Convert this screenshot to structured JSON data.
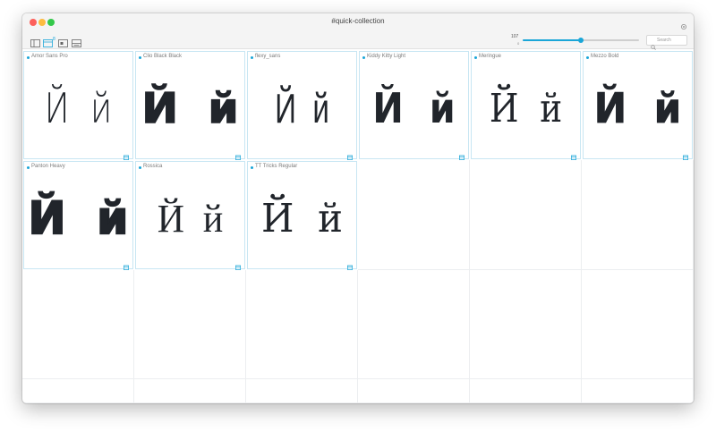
{
  "window": {
    "title": "#quick-collection"
  },
  "toolbar": {
    "count": "8",
    "size_value": "107",
    "size_min": "0",
    "size_level": 0.5,
    "search_placeholder": "Search"
  },
  "colors": {
    "accent": "#1aa6d8",
    "glyph": "#21252b"
  },
  "sample": "Й  й",
  "fonts": [
    {
      "name": "Amor Sans Pro",
      "style": "light-sans"
    },
    {
      "name": "Clio Black Black",
      "style": "black-sans"
    },
    {
      "name": "flexy_sans",
      "style": "condensed-sans"
    },
    {
      "name": "Kiddy Kitty Light",
      "style": "rounded"
    },
    {
      "name": "Meringue",
      "style": "serif-light"
    },
    {
      "name": "Mezzo Bold",
      "style": "bold-sans"
    },
    {
      "name": "Panton Heavy",
      "style": "heavy-rounded"
    },
    {
      "name": "Rossica",
      "style": "serif"
    },
    {
      "name": "TT Tricks Regular",
      "style": "serif-regular"
    }
  ]
}
